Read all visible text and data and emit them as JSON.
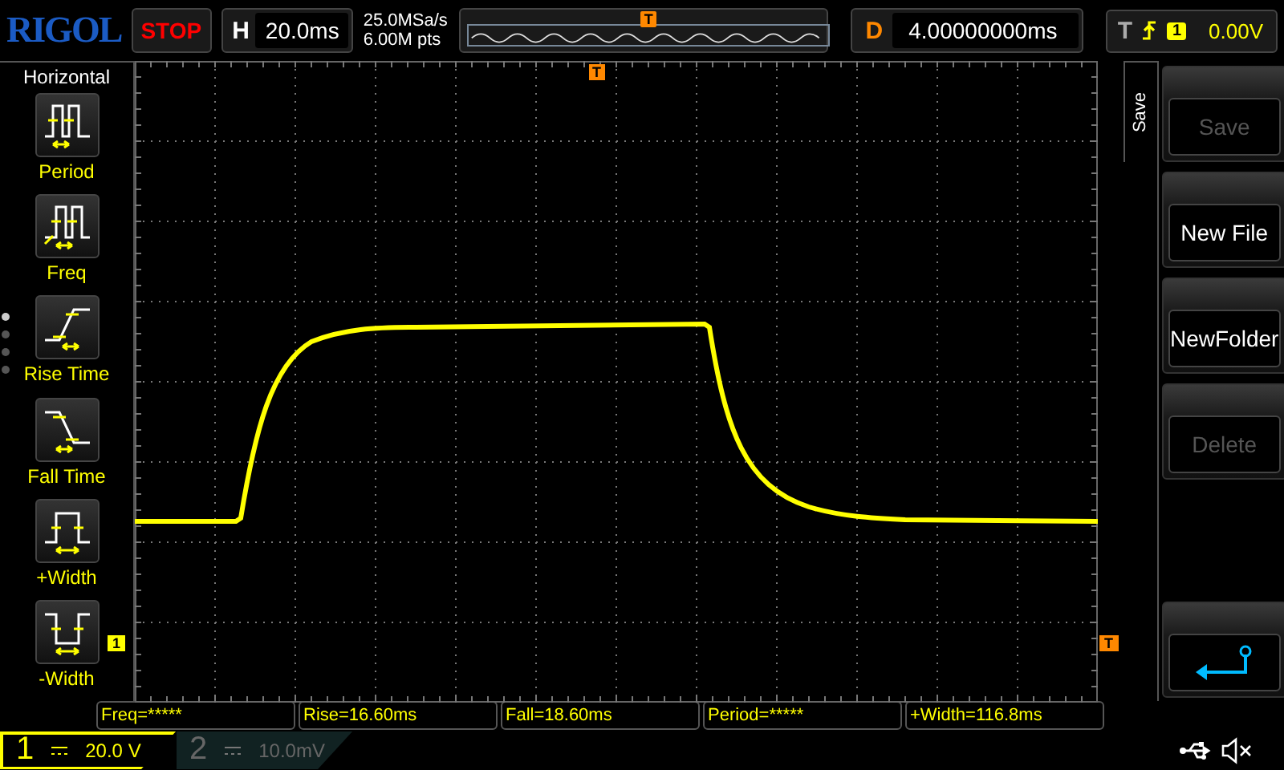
{
  "brand": "RIGOL",
  "run_state": "STOP",
  "timebase": {
    "label": "H",
    "value": "20.0ms"
  },
  "sample_rate": "25.0MSa/s",
  "memory_depth": "6.00M pts",
  "overview_marker": "T",
  "delay": {
    "label": "D",
    "value": "4.00000000ms"
  },
  "trigger": {
    "label": "T",
    "source": "1",
    "level": "0.00V"
  },
  "left_menu": {
    "title": "Horizontal",
    "items": [
      {
        "label": "Period",
        "kind": "period"
      },
      {
        "label": "Freq",
        "kind": "freq"
      },
      {
        "label": "Rise Time",
        "kind": "rise"
      },
      {
        "label": "Fall Time",
        "kind": "fall"
      },
      {
        "label": "+Width",
        "kind": "pwidth"
      },
      {
        "label": "-Width",
        "kind": "nwidth"
      }
    ]
  },
  "plot": {
    "trigger_marker": "T",
    "channel_marker": "1",
    "level_marker": "T"
  },
  "right_menu": {
    "title": "Save",
    "items": [
      {
        "kind": "text",
        "label": "Save",
        "disabled": true
      },
      {
        "kind": "text",
        "label": "New File",
        "disabled": false
      },
      {
        "kind": "text",
        "label": "NewFolder",
        "disabled": false
      },
      {
        "kind": "text",
        "label": "Delete",
        "disabled": true
      },
      {
        "kind": "back"
      }
    ]
  },
  "measurements": [
    "Freq=*****",
    "Rise=16.60ms",
    "Fall=18.60ms",
    "Period=*****",
    "+Width=116.8ms"
  ],
  "channels": [
    {
      "number": "1",
      "scale": "20.0 V",
      "on": true
    },
    {
      "number": "2",
      "scale": "10.0mV",
      "on": false
    }
  ]
}
